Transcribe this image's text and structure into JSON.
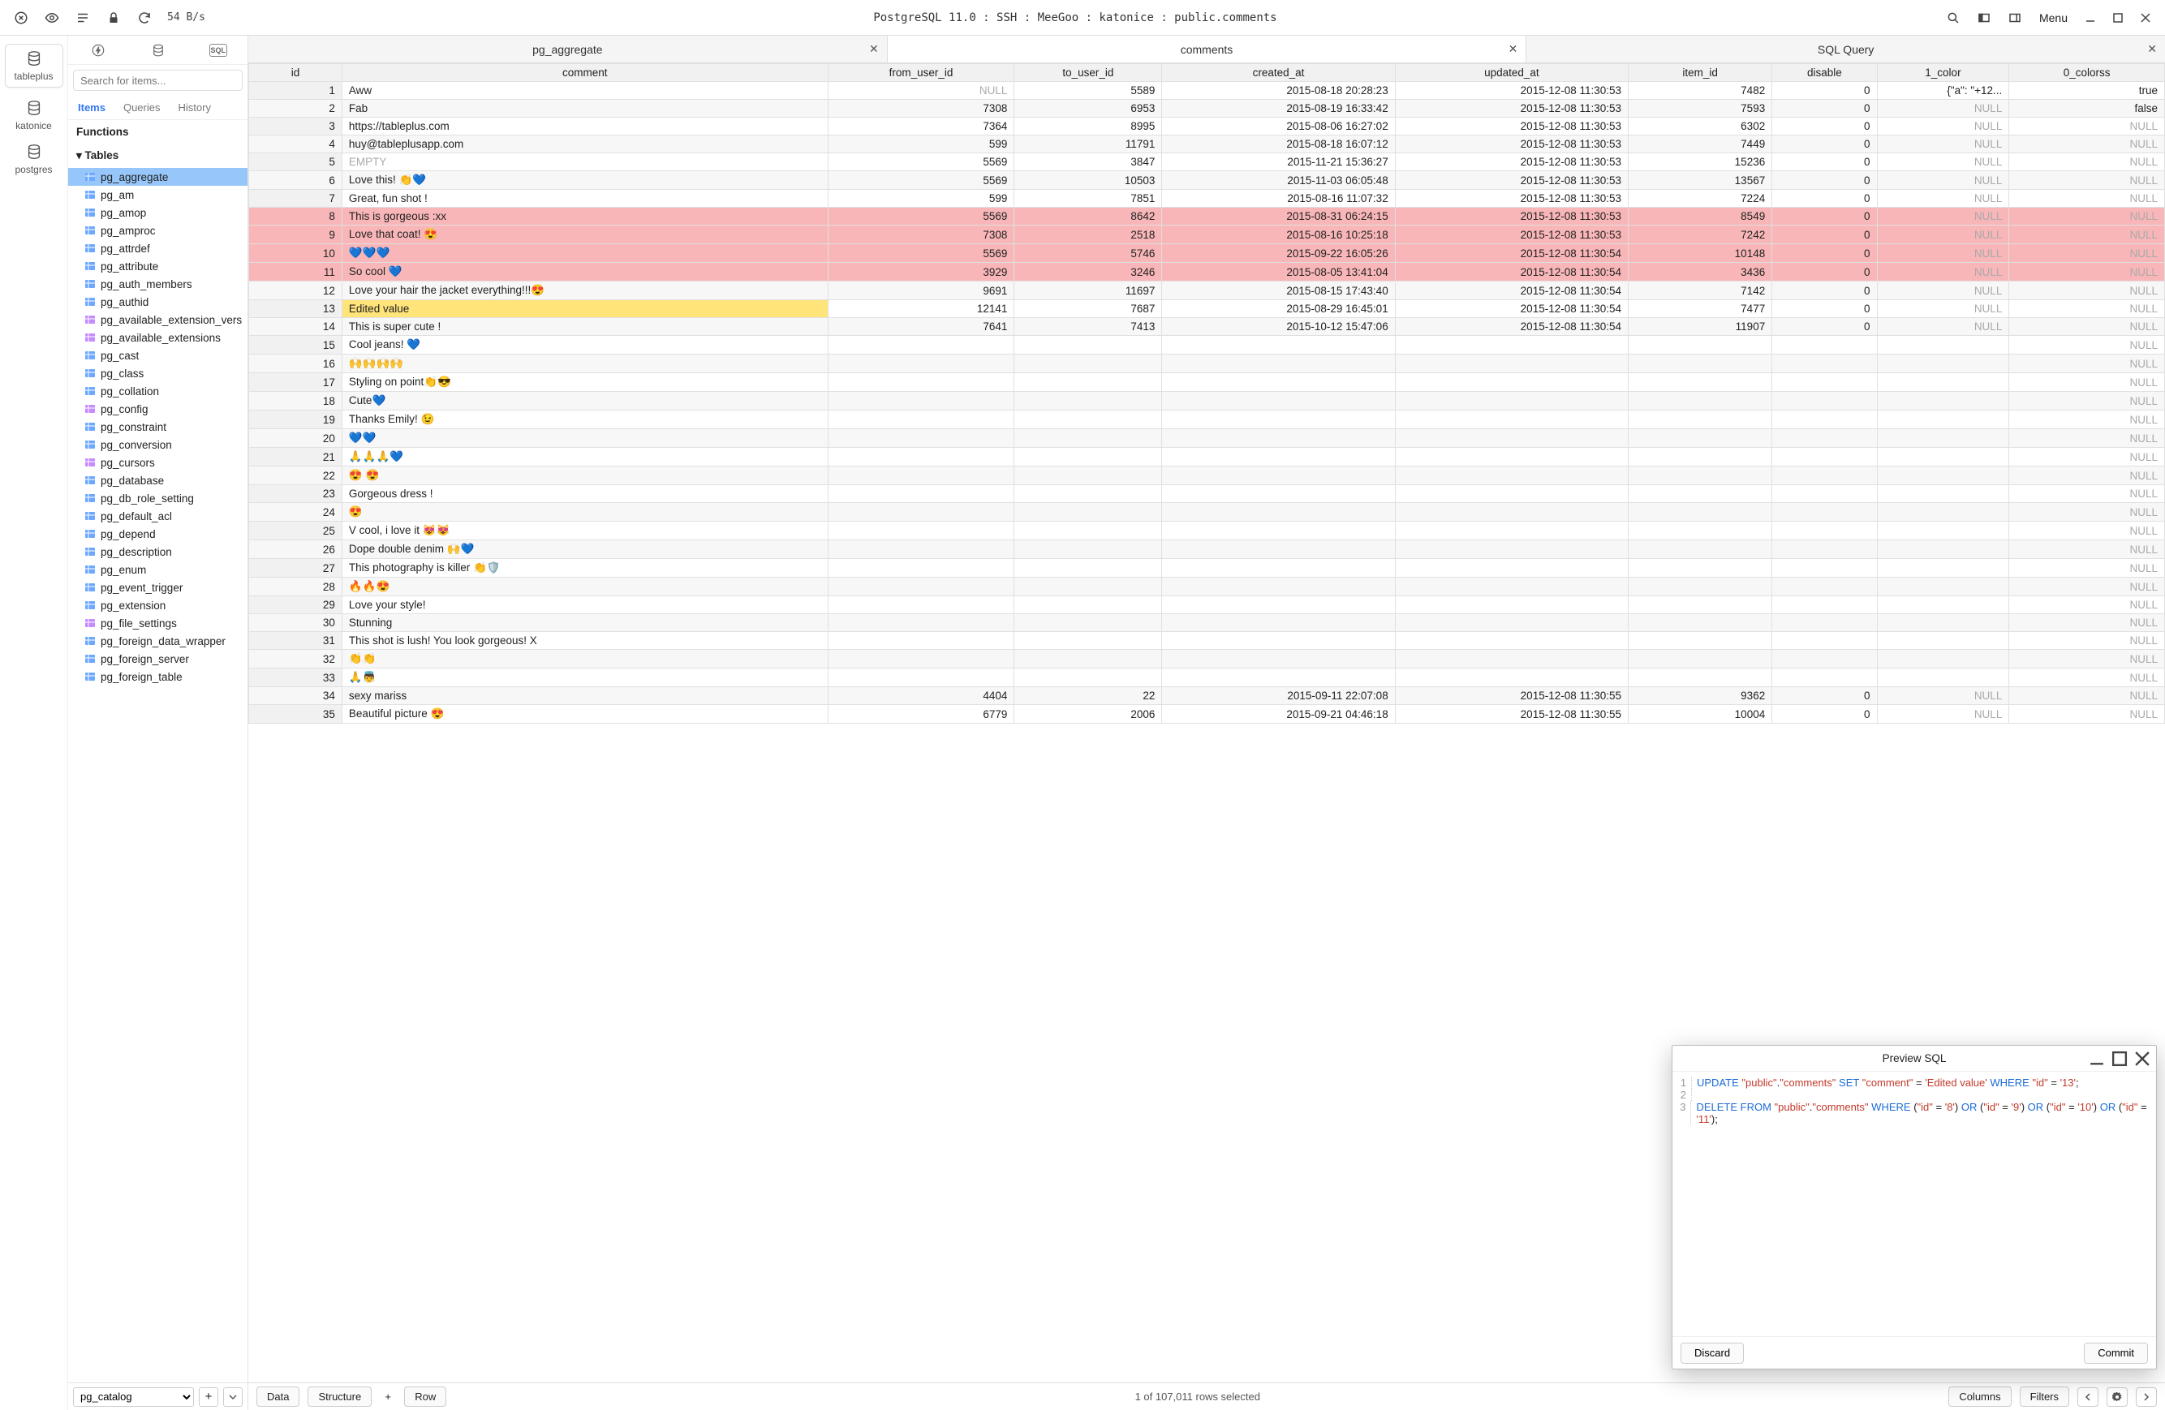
{
  "toolbar": {
    "rate": "54 B/s",
    "title": "PostgreSQL 11.0 : SSH : MeeGoo : katonice : public.comments",
    "menu": "Menu"
  },
  "rail": [
    {
      "label": "tableplus",
      "active": true
    },
    {
      "label": "katonice",
      "active": false
    },
    {
      "label": "postgres",
      "active": false
    }
  ],
  "sidebar": {
    "search_placeholder": "Search for items...",
    "tabs": {
      "items": "Items",
      "queries": "Queries",
      "history": "History"
    },
    "functions_label": "Functions",
    "tables_label": "Tables",
    "tables": [
      {
        "name": "pg_aggregate",
        "kind": "table",
        "selected": true
      },
      {
        "name": "pg_am",
        "kind": "table"
      },
      {
        "name": "pg_amop",
        "kind": "table"
      },
      {
        "name": "pg_amproc",
        "kind": "table"
      },
      {
        "name": "pg_attrdef",
        "kind": "table"
      },
      {
        "name": "pg_attribute",
        "kind": "table"
      },
      {
        "name": "pg_auth_members",
        "kind": "table"
      },
      {
        "name": "pg_authid",
        "kind": "table"
      },
      {
        "name": "pg_available_extension_vers",
        "kind": "view"
      },
      {
        "name": "pg_available_extensions",
        "kind": "view"
      },
      {
        "name": "pg_cast",
        "kind": "table"
      },
      {
        "name": "pg_class",
        "kind": "table"
      },
      {
        "name": "pg_collation",
        "kind": "table"
      },
      {
        "name": "pg_config",
        "kind": "view"
      },
      {
        "name": "pg_constraint",
        "kind": "table"
      },
      {
        "name": "pg_conversion",
        "kind": "table"
      },
      {
        "name": "pg_cursors",
        "kind": "view"
      },
      {
        "name": "pg_database",
        "kind": "table"
      },
      {
        "name": "pg_db_role_setting",
        "kind": "table"
      },
      {
        "name": "pg_default_acl",
        "kind": "table"
      },
      {
        "name": "pg_depend",
        "kind": "table"
      },
      {
        "name": "pg_description",
        "kind": "table"
      },
      {
        "name": "pg_enum",
        "kind": "table"
      },
      {
        "name": "pg_event_trigger",
        "kind": "table"
      },
      {
        "name": "pg_extension",
        "kind": "table"
      },
      {
        "name": "pg_file_settings",
        "kind": "view"
      },
      {
        "name": "pg_foreign_data_wrapper",
        "kind": "table"
      },
      {
        "name": "pg_foreign_server",
        "kind": "table"
      },
      {
        "name": "pg_foreign_table",
        "kind": "table"
      }
    ],
    "schema_select": "pg_catalog"
  },
  "tabs": [
    {
      "label": "pg_aggregate",
      "active": false
    },
    {
      "label": "comments",
      "active": true
    },
    {
      "label": "SQL Query",
      "active": false
    }
  ],
  "columns": [
    "id",
    "comment",
    "from_user_id",
    "to_user_id",
    "created_at",
    "updated_at",
    "item_id",
    "disable",
    "1_color",
    "0_colorss"
  ],
  "rows": [
    {
      "id": 1,
      "comment": "Aww",
      "from": "NULL",
      "to": "5589",
      "created": "2015-08-18 20:28:23",
      "updated": "2015-12-08 11:30:53",
      "item": "7482",
      "disable": "0",
      "c1": "{\"a\": \"+12...",
      "c2": "true"
    },
    {
      "id": 2,
      "comment": "Fab",
      "from": "7308",
      "to": "6953",
      "created": "2015-08-19 16:33:42",
      "updated": "2015-12-08 11:30:53",
      "item": "7593",
      "disable": "0",
      "c1": "NULL",
      "c2": "false"
    },
    {
      "id": 3,
      "comment": "https://tableplus.com",
      "from": "7364",
      "to": "8995",
      "created": "2015-08-06 16:27:02",
      "updated": "2015-12-08 11:30:53",
      "item": "6302",
      "disable": "0",
      "c1": "NULL",
      "c2": "NULL"
    },
    {
      "id": 4,
      "comment": "huy@tableplusapp.com",
      "from": "599",
      "to": "11791",
      "created": "2015-08-18 16:07:12",
      "updated": "2015-12-08 11:30:53",
      "item": "7449",
      "disable": "0",
      "c1": "NULL",
      "c2": "NULL"
    },
    {
      "id": 5,
      "comment": "EMPTY",
      "from": "5569",
      "to": "3847",
      "created": "2015-11-21 15:36:27",
      "updated": "2015-12-08 11:30:53",
      "item": "15236",
      "disable": "0",
      "c1": "NULL",
      "c2": "NULL",
      "empty": true
    },
    {
      "id": 6,
      "comment": "Love this! 👏💙",
      "from": "5569",
      "to": "10503",
      "created": "2015-11-03 06:05:48",
      "updated": "2015-12-08 11:30:53",
      "item": "13567",
      "disable": "0",
      "c1": "NULL",
      "c2": "NULL"
    },
    {
      "id": 7,
      "comment": "Great, fun shot !",
      "from": "599",
      "to": "7851",
      "created": "2015-08-16 11:07:32",
      "updated": "2015-12-08 11:30:53",
      "item": "7224",
      "disable": "0",
      "c1": "NULL",
      "c2": "NULL"
    },
    {
      "id": 8,
      "comment": "This is gorgeous :xx",
      "from": "5569",
      "to": "8642",
      "created": "2015-08-31 06:24:15",
      "updated": "2015-12-08 11:30:53",
      "item": "8549",
      "disable": "0",
      "c1": "NULL",
      "c2": "NULL",
      "state": "deleted"
    },
    {
      "id": 9,
      "comment": "Love that coat! 😍",
      "from": "7308",
      "to": "2518",
      "created": "2015-08-16 10:25:18",
      "updated": "2015-12-08 11:30:53",
      "item": "7242",
      "disable": "0",
      "c1": "NULL",
      "c2": "NULL",
      "state": "deleted"
    },
    {
      "id": 10,
      "comment": "💙💙💙",
      "from": "5569",
      "to": "5746",
      "created": "2015-09-22 16:05:26",
      "updated": "2015-12-08 11:30:54",
      "item": "10148",
      "disable": "0",
      "c1": "NULL",
      "c2": "NULL",
      "state": "deleted"
    },
    {
      "id": 11,
      "comment": "So cool 💙",
      "from": "3929",
      "to": "3246",
      "created": "2015-08-05 13:41:04",
      "updated": "2015-12-08 11:30:54",
      "item": "3436",
      "disable": "0",
      "c1": "NULL",
      "c2": "NULL",
      "state": "deleted"
    },
    {
      "id": 12,
      "comment": "Love your hair the jacket everything!!!😍",
      "from": "9691",
      "to": "11697",
      "created": "2015-08-15 17:43:40",
      "updated": "2015-12-08 11:30:54",
      "item": "7142",
      "disable": "0",
      "c1": "NULL",
      "c2": "NULL"
    },
    {
      "id": 13,
      "comment": "Edited value",
      "from": "12141",
      "to": "7687",
      "created": "2015-08-29 16:45:01",
      "updated": "2015-12-08 11:30:54",
      "item": "7477",
      "disable": "0",
      "c1": "NULL",
      "c2": "NULL",
      "state": "edited"
    },
    {
      "id": 14,
      "comment": "This is super cute    !",
      "from": "7641",
      "to": "7413",
      "created": "2015-10-12 15:47:06",
      "updated": "2015-12-08 11:30:54",
      "item": "11907",
      "disable": "0",
      "c1": "NULL",
      "c2": "NULL"
    },
    {
      "id": 15,
      "comment": "Cool jeans! 💙",
      "c2": "NULL"
    },
    {
      "id": 16,
      "comment": "🙌🙌🙌🙌",
      "c2": "NULL"
    },
    {
      "id": 17,
      "comment": "Styling on point👏😎",
      "c2": "NULL"
    },
    {
      "id": 18,
      "comment": "Cute💙",
      "c2": "NULL"
    },
    {
      "id": 19,
      "comment": "Thanks Emily! 😉",
      "c2": "NULL"
    },
    {
      "id": 20,
      "comment": "💙💙",
      "c2": "NULL"
    },
    {
      "id": 21,
      "comment": "🙏🙏🙏💙",
      "c2": "NULL"
    },
    {
      "id": 22,
      "comment": "😍 😍",
      "c2": "NULL"
    },
    {
      "id": 23,
      "comment": "Gorgeous dress !",
      "c2": "NULL"
    },
    {
      "id": 24,
      "comment": "😍",
      "c2": "NULL"
    },
    {
      "id": 25,
      "comment": "V cool, i love it 😻😻",
      "c2": "NULL"
    },
    {
      "id": 26,
      "comment": "Dope double denim 🙌💙",
      "c2": "NULL"
    },
    {
      "id": 27,
      "comment": "This photography is killer 👏🛡️",
      "c2": "NULL"
    },
    {
      "id": 28,
      "comment": "🔥🔥😍",
      "c2": "NULL"
    },
    {
      "id": 29,
      "comment": "Love your style!",
      "c2": "NULL"
    },
    {
      "id": 30,
      "comment": "Stunning",
      "c2": "NULL"
    },
    {
      "id": 31,
      "comment": "This shot is lush! You look gorgeous! X",
      "c2": "NULL"
    },
    {
      "id": 32,
      "comment": "👏👏",
      "c2": "NULL"
    },
    {
      "id": 33,
      "comment": "🙏👼",
      "c2": "NULL"
    },
    {
      "id": 34,
      "comment": "sexy mariss",
      "from": "4404",
      "to": "22",
      "created": "2015-09-11 22:07:08",
      "updated": "2015-12-08 11:30:55",
      "item": "9362",
      "disable": "0",
      "c1": "NULL",
      "c2": "NULL"
    },
    {
      "id": 35,
      "comment": "Beautiful picture 😍",
      "from": "6779",
      "to": "2006",
      "created": "2015-09-21 04:46:18",
      "updated": "2015-12-08 11:30:55",
      "item": "10004",
      "disable": "0",
      "c1": "NULL",
      "c2": "NULL"
    }
  ],
  "status": {
    "data": "Data",
    "structure": "Structure",
    "row": "Row",
    "center": "1 of 107,011 rows selected",
    "columns": "Columns",
    "filters": "Filters"
  },
  "preview": {
    "title": "Preview SQL",
    "discard": "Discard",
    "commit": "Commit",
    "sql": [
      {
        "n": 1,
        "tokens": [
          [
            "kw",
            "UPDATE "
          ],
          [
            "str",
            "\"public\""
          ],
          [
            "",
            "."
          ],
          [
            "str",
            "\"comments\""
          ],
          [
            "kw",
            " SET "
          ],
          [
            "str",
            "\"comment\""
          ],
          [
            "",
            " = "
          ],
          [
            "str",
            "'Edited value'"
          ],
          [
            "kw",
            " WHERE "
          ],
          [
            "str",
            "\"id\""
          ],
          [
            "",
            " = "
          ],
          [
            "str",
            "'13'"
          ],
          [
            "",
            ";"
          ]
        ]
      },
      {
        "n": 2,
        "tokens": [
          [
            "",
            ""
          ]
        ]
      },
      {
        "n": 3,
        "tokens": [
          [
            "kw",
            "DELETE FROM "
          ],
          [
            "str",
            "\"public\""
          ],
          [
            "",
            "."
          ],
          [
            "str",
            "\"comments\""
          ],
          [
            "kw",
            " WHERE "
          ],
          [
            "",
            "("
          ],
          [
            "str",
            "\"id\""
          ],
          [
            "",
            " = "
          ],
          [
            "str",
            "'8'"
          ],
          [
            "",
            ") "
          ],
          [
            "kw",
            "OR"
          ],
          [
            "",
            " ("
          ],
          [
            "str",
            "\"id\""
          ],
          [
            "",
            " = "
          ],
          [
            "str",
            "'9'"
          ],
          [
            "",
            ") "
          ],
          [
            "kw",
            "OR"
          ],
          [
            "",
            " ("
          ],
          [
            "str",
            "\"id\""
          ],
          [
            "",
            " = "
          ],
          [
            "str",
            "'10'"
          ],
          [
            "",
            ") "
          ],
          [
            "kw",
            "OR"
          ],
          [
            "",
            " ("
          ],
          [
            "str",
            "\"id\""
          ],
          [
            "",
            " = "
          ],
          [
            "str",
            "'11'"
          ],
          [
            "",
            ");"
          ]
        ]
      }
    ]
  }
}
